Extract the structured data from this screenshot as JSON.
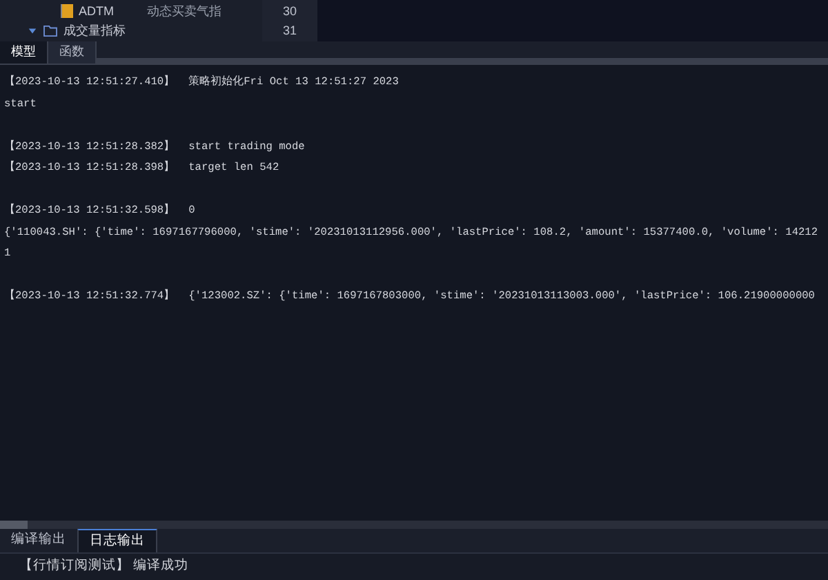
{
  "tree": {
    "items": [
      {
        "label": "ADTM",
        "note": "动态买卖气指",
        "kind": "indicator"
      },
      {
        "label": "成交量指标",
        "kind": "folder",
        "expanded": true
      }
    ]
  },
  "line_numbers": [
    "30",
    "31"
  ],
  "panel_tabs": [
    {
      "label": "模型",
      "selected": true
    },
    {
      "label": "函数",
      "selected": false
    }
  ],
  "log": [
    {
      "kind": "stamped",
      "time": "【2023-10-13 12:51:27.410】",
      "text": "策略初始化Fri Oct 13 12:51:27 2023"
    },
    {
      "kind": "plain",
      "text": "start"
    },
    {
      "kind": "blank"
    },
    {
      "kind": "stamped",
      "time": "【2023-10-13 12:51:28.382】",
      "text": "start trading mode"
    },
    {
      "kind": "stamped",
      "time": "【2023-10-13 12:51:28.398】",
      "text": "target len 542"
    },
    {
      "kind": "blank"
    },
    {
      "kind": "stamped",
      "time": "【2023-10-13 12:51:32.598】",
      "text": "0"
    },
    {
      "kind": "plain",
      "text": "{'110043.SH': {'time': 1697167796000, 'stime': '20231013112956.000', 'lastPrice': 108.2, 'amount': 15377400.0, 'volume': 14212"
    },
    {
      "kind": "plain",
      "text": "1"
    },
    {
      "kind": "blank"
    },
    {
      "kind": "stamped",
      "time": "【2023-10-13 12:51:32.774】",
      "text": "{'123002.SZ': {'time': 1697167803000, 'stime': '20231013113003.000', 'lastPrice': 106.21900000000"
    }
  ],
  "output_tabs": [
    {
      "label": "编译输出",
      "selected": false
    },
    {
      "label": "日志输出",
      "selected": true
    }
  ],
  "status": "【行情订阅测试】 编译成功"
}
